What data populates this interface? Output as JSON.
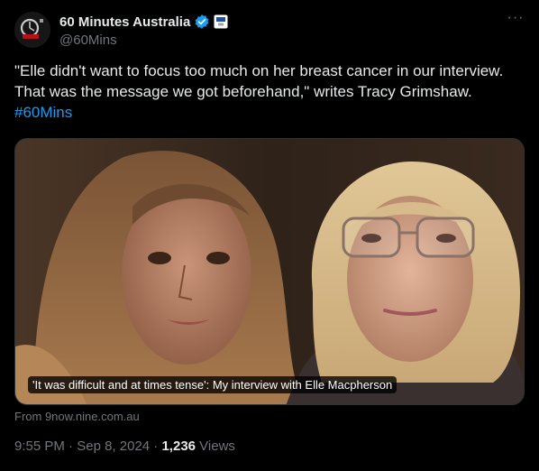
{
  "author": {
    "display_name": "60 Minutes Australia",
    "handle": "@60Mins",
    "verified_color": "#1d9bf0"
  },
  "more_label": "···",
  "tweet": {
    "text": "\"Elle didn't want to focus too much on her breast cancer in our interview.\nThat was the message we got beforehand,\" writes Tracy Grimshaw.",
    "hashtag": "#60Mins"
  },
  "card": {
    "caption": "'It was difficult and at times tense': My interview with Elle Macpherson",
    "source": "From 9now.nine.com.au"
  },
  "meta": {
    "time": "9:55 PM",
    "separator": " · ",
    "date": "Sep 8, 2024",
    "separator2": " · ",
    "views_count": "1,236",
    "views_label": " Views"
  },
  "colors": {
    "background": "#000000",
    "text": "#e7e9ea",
    "muted": "#71767b",
    "link": "#1d9bf0"
  }
}
